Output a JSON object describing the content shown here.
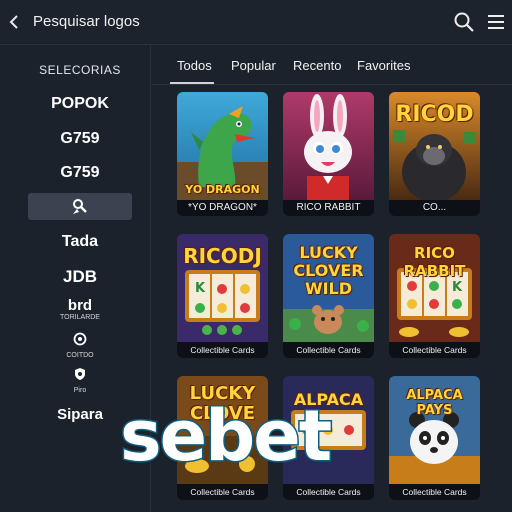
{
  "header": {
    "title": "Pesquisar logos",
    "back_icon": "chevron-left-icon",
    "search_icon": "search-icon",
    "menu_icon": "hamburger-menu-icon"
  },
  "sidebar": {
    "heading": "SELECORIAS",
    "items": [
      {
        "label": "POPOK"
      },
      {
        "label": "G759"
      },
      {
        "label": "G759"
      },
      {
        "label": "",
        "icon": "magnifier-figure-icon",
        "selected": true
      },
      {
        "label": "Tada"
      },
      {
        "label": "JDB"
      },
      {
        "label": "brd",
        "sub": "TORILARDE"
      },
      {
        "label": "",
        "sub": "COITDO",
        "icon": "gear-circle-icon"
      },
      {
        "label": "",
        "sub": "Piro",
        "icon": "shield-icon"
      },
      {
        "label": "Sipara"
      }
    ]
  },
  "tabs": [
    {
      "label": "Todos",
      "active": true
    },
    {
      "label": "Popular"
    },
    {
      "label": "Recento"
    },
    {
      "label": "Favorites"
    }
  ],
  "cards": [
    {
      "art_title": "YO DRAGON",
      "label": "*YO DRAGON*"
    },
    {
      "art_title": "",
      "label": "RICO RABBIT"
    },
    {
      "art_title": "RICOD",
      "label": "CO..."
    },
    {
      "art_title": "RICODJ",
      "label": "Collectible Cards"
    },
    {
      "art_title": "LUCKY CLOVER WILD",
      "art_lines": [
        "LUCKY",
        "CLOVER",
        "WILD"
      ],
      "label": "Collectible Cards"
    },
    {
      "art_title": "RICO RABBIT",
      "label": "Collectible Cards"
    },
    {
      "art_title": "LUCKY CLOVE",
      "art_lines": [
        "LUCKY",
        "CLOVE"
      ],
      "label": "Collectible Cards"
    },
    {
      "art_title": "ALPACA",
      "label": "Collectible Cards"
    },
    {
      "art_title": "ALPACA PAYS",
      "label": "Collectible Cards"
    }
  ],
  "watermark": "sebet",
  "colors": {
    "background": "#1b222c",
    "selected_item": "#3b4350",
    "label_bar": "#0a0c12",
    "title_gold": "#ffd53d",
    "watermark_stroke": "#0d5f80"
  }
}
